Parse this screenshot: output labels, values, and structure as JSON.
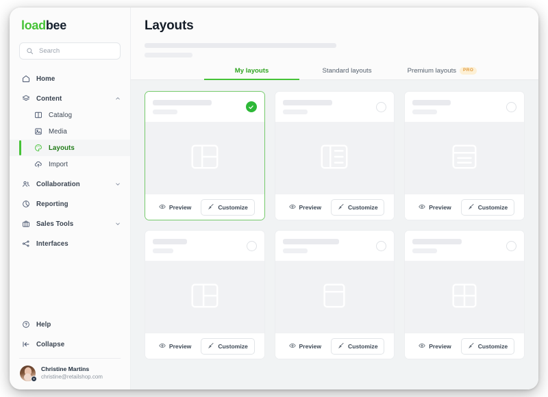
{
  "brand": {
    "name_part1": "load",
    "name_part2": "bee"
  },
  "search": {
    "placeholder": "Search",
    "icon": "search-icon"
  },
  "sidebar": {
    "items": [
      {
        "label": "Home",
        "icon": "home-icon",
        "level": "top",
        "chevron": "none",
        "active": false
      },
      {
        "label": "Content",
        "icon": "layers-icon",
        "level": "top",
        "chevron": "up",
        "active": false
      },
      {
        "label": "Catalog",
        "icon": "book-icon",
        "level": "sub",
        "chevron": "none",
        "active": false
      },
      {
        "label": "Media",
        "icon": "image-icon",
        "level": "sub",
        "chevron": "none",
        "active": false
      },
      {
        "label": "Layouts",
        "icon": "palette-icon",
        "level": "sub",
        "chevron": "none",
        "active": true
      },
      {
        "label": "Import",
        "icon": "cloud-upload-icon",
        "level": "sub",
        "chevron": "none",
        "active": false
      },
      {
        "label": "Collaboration",
        "icon": "users-icon",
        "level": "top",
        "chevron": "down",
        "active": false
      },
      {
        "label": "Reporting",
        "icon": "pie-chart-icon",
        "level": "top",
        "chevron": "none",
        "active": false
      },
      {
        "label": "Sales Tools",
        "icon": "briefcase-icon",
        "level": "top",
        "chevron": "down",
        "active": false
      },
      {
        "label": "Interfaces",
        "icon": "nodes-icon",
        "level": "top",
        "chevron": "none",
        "active": false
      }
    ],
    "help": {
      "label": "Help",
      "icon": "question-circle-icon"
    },
    "collapse": {
      "label": "Collapse",
      "icon": "collapse-left-icon"
    },
    "user": {
      "name": "Christine Martins",
      "email": "christine@retailshop.com",
      "avatar": "avatar",
      "badge_icon": "settings-badge-icon"
    }
  },
  "header": {
    "title": "Layouts",
    "skeleton_line_1": "",
    "skeleton_line_2": ""
  },
  "tabs": [
    {
      "label": "My layouts",
      "active": true,
      "badge": null
    },
    {
      "label": "Standard layouts",
      "active": false,
      "badge": null
    },
    {
      "label": "Premium layouts",
      "active": false,
      "badge": "PRO"
    }
  ],
  "actions": {
    "preview_label": "Preview",
    "preview_icon": "eye-icon",
    "customize_label": "Customize",
    "customize_icon": "brush-icon"
  },
  "cards": [
    {
      "selected": true,
      "status_icon": "check-circle-icon",
      "thumb": "layout-sidebar-split-icon",
      "title_width": 86,
      "sub_width": 36
    },
    {
      "selected": false,
      "status_icon": "radio-empty-icon",
      "thumb": "layout-sidebar-lines-icon",
      "title_width": 72,
      "sub_width": 36
    },
    {
      "selected": false,
      "status_icon": "radio-empty-icon",
      "thumb": "layout-header-lines-icon",
      "title_width": 56,
      "sub_width": 36
    },
    {
      "selected": false,
      "status_icon": "radio-empty-icon",
      "thumb": "layout-left-right-split-icon",
      "title_width": 50,
      "sub_width": 30
    },
    {
      "selected": false,
      "status_icon": "radio-empty-icon",
      "thumb": "layout-header-body-icon",
      "title_width": 82,
      "sub_width": 36
    },
    {
      "selected": false,
      "status_icon": "radio-empty-icon",
      "thumb": "layout-grid-2x2-icon",
      "title_width": 72,
      "sub_width": 36
    }
  ],
  "colors": {
    "brand_green": "#45c236",
    "accent_green": "#2db837",
    "pro_bg": "#fdf0d5",
    "pro_text": "#e09a3e",
    "main_bg": "#f1f3f4",
    "sidebar_bg": "#fbfbfb"
  }
}
